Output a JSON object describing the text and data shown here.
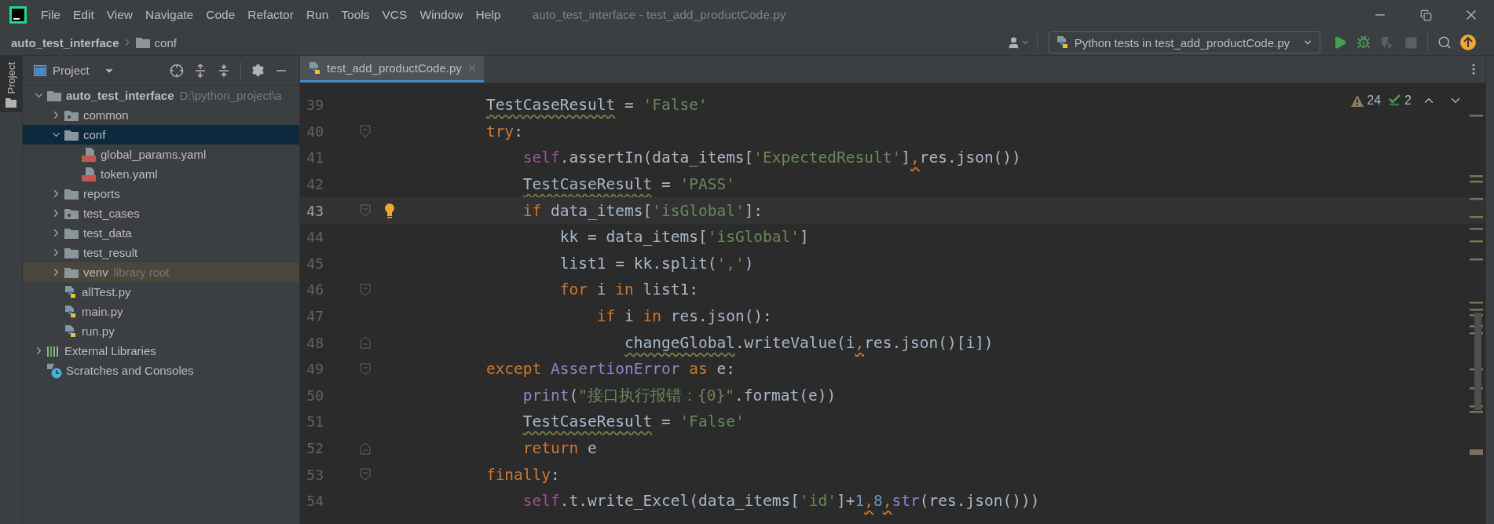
{
  "window": {
    "title": "auto_test_interface - test_add_productCode.py"
  },
  "menu": [
    "File",
    "Edit",
    "View",
    "Navigate",
    "Code",
    "Refactor",
    "Run",
    "Tools",
    "VCS",
    "Window",
    "Help"
  ],
  "breadcrumb": [
    {
      "label": "auto_test_interface",
      "kind": "project"
    },
    {
      "label": "conf",
      "kind": "folder"
    }
  ],
  "toolbar": {
    "run_config": "Python tests in test_add_productCode.py",
    "buttons": [
      {
        "kind": "run",
        "disabled": false
      },
      {
        "kind": "debug",
        "disabled": false
      },
      {
        "kind": "coverage",
        "disabled": true
      },
      {
        "kind": "stop",
        "disabled": true
      },
      {
        "kind": "search",
        "disabled": false
      },
      {
        "kind": "update",
        "disabled": false
      }
    ]
  },
  "tool_strip": {
    "tabs": [
      {
        "label": "Project",
        "selected": true
      }
    ]
  },
  "project_panel": {
    "title": "Project",
    "tree": [
      {
        "label": "auto_test_interface",
        "hint": "D:\\python_project\\a",
        "kind": "project",
        "expanded": true,
        "selected": false,
        "children": [
          {
            "label": "common",
            "kind": "package",
            "expanded": false,
            "selected": false
          },
          {
            "label": "conf",
            "kind": "folder",
            "expanded": true,
            "selected": true,
            "children": [
              {
                "label": "global_params.yaml",
                "kind": "yaml",
                "selected": false
              },
              {
                "label": "token.yaml",
                "kind": "yaml",
                "selected": false
              }
            ]
          },
          {
            "label": "reports",
            "kind": "folder",
            "expanded": false,
            "selected": false
          },
          {
            "label": "test_cases",
            "kind": "package",
            "expanded": false,
            "selected": false
          },
          {
            "label": "test_data",
            "kind": "folder",
            "expanded": false,
            "selected": false
          },
          {
            "label": "test_result",
            "kind": "folder",
            "expanded": false,
            "selected": false
          },
          {
            "label": "venv",
            "hint": "library root",
            "kind": "library-folder",
            "expanded": false,
            "selected": false
          },
          {
            "label": "allTest.py",
            "kind": "python",
            "selected": false
          },
          {
            "label": "main.py",
            "kind": "python",
            "selected": false
          },
          {
            "label": "run.py",
            "kind": "python",
            "selected": false
          }
        ]
      },
      {
        "label": "External Libraries",
        "kind": "libraries",
        "expanded": false,
        "selected": false
      },
      {
        "label": "Scratches and Consoles",
        "kind": "scratches",
        "selected": false
      }
    ]
  },
  "editor": {
    "tabs": [
      {
        "label": "test_add_productCode.py",
        "selected": true
      }
    ],
    "inspections": {
      "warnings": "24",
      "typos": "2"
    },
    "lines": [
      {
        "number": "39",
        "current": false,
        "fold_start": false,
        "fold_end": false,
        "bulb": false,
        "tokens": [
          {
            "text": "            TestCaseResult",
            "kind": "warned"
          },
          {
            "text": " = ",
            "kind": "plain"
          },
          {
            "text": "'False'",
            "kind": "string"
          }
        ]
      },
      {
        "number": "40",
        "current": false,
        "fold_start": true,
        "fold_end": false,
        "bulb": false,
        "tokens": [
          {
            "text": "            try",
            "kind": "keyword"
          },
          {
            "text": ":",
            "kind": "plain"
          }
        ]
      },
      {
        "number": "41",
        "current": false,
        "fold_start": false,
        "fold_end": false,
        "bulb": false,
        "tokens": [
          {
            "text": "                self",
            "kind": "self"
          },
          {
            "text": ".assertIn(data_items[",
            "kind": "plain"
          },
          {
            "text": "'ExpectedResult'",
            "kind": "string"
          },
          {
            "text": "]",
            "kind": "plain"
          },
          {
            "text": ",res.json())",
            "kind": "flagged-plain"
          }
        ]
      },
      {
        "number": "42",
        "current": false,
        "fold_start": false,
        "fold_end": false,
        "bulb": false,
        "tokens": [
          {
            "text": "                TestCaseResult",
            "kind": "warned"
          },
          {
            "text": " = ",
            "kind": "plain"
          },
          {
            "text": "'PASS'",
            "kind": "string"
          }
        ]
      },
      {
        "number": "43",
        "current": true,
        "fold_start": true,
        "fold_end": false,
        "bulb": true,
        "tokens": [
          {
            "text": "                if",
            "kind": "keyword"
          },
          {
            "text": " data_items[",
            "kind": "plain"
          },
          {
            "text": "'isGlobal'",
            "kind": "string"
          },
          {
            "text": "]:",
            "kind": "plain"
          }
        ]
      },
      {
        "number": "44",
        "current": false,
        "fold_start": false,
        "fold_end": false,
        "bulb": false,
        "tokens": [
          {
            "text": "                    kk = data_items[",
            "kind": "plain"
          },
          {
            "text": "'isGlobal'",
            "kind": "string"
          },
          {
            "text": "]",
            "kind": "plain"
          }
        ]
      },
      {
        "number": "45",
        "current": false,
        "fold_start": false,
        "fold_end": false,
        "bulb": false,
        "tokens": [
          {
            "text": "                    list1 = kk.split(",
            "kind": "plain"
          },
          {
            "text": "','",
            "kind": "string"
          },
          {
            "text": ")",
            "kind": "plain"
          }
        ]
      },
      {
        "number": "46",
        "current": false,
        "fold_start": true,
        "fold_end": false,
        "bulb": false,
        "tokens": [
          {
            "text": "                    for",
            "kind": "keyword"
          },
          {
            "text": " i ",
            "kind": "plain"
          },
          {
            "text": "in",
            "kind": "keyword"
          },
          {
            "text": " list1:",
            "kind": "plain"
          }
        ]
      },
      {
        "number": "47",
        "current": false,
        "fold_start": false,
        "fold_end": false,
        "bulb": false,
        "tokens": [
          {
            "text": "                        if",
            "kind": "keyword"
          },
          {
            "text": " i ",
            "kind": "plain"
          },
          {
            "text": "in",
            "kind": "keyword"
          },
          {
            "text": " res.json():",
            "kind": "plain"
          }
        ]
      },
      {
        "number": "48",
        "current": false,
        "fold_start": false,
        "fold_end": true,
        "bulb": false,
        "tokens": [
          {
            "text": "                           changeGlobal",
            "kind": "warned"
          },
          {
            "text": ".writeValue(i",
            "kind": "plain"
          },
          {
            "text": ",res.json()[i])",
            "kind": "flagged-plain"
          }
        ]
      },
      {
        "number": "49",
        "current": false,
        "fold_start": true,
        "fold_end": false,
        "bulb": false,
        "tokens": [
          {
            "text": "            except ",
            "kind": "keyword"
          },
          {
            "text": "AssertionError",
            "kind": "builtin"
          },
          {
            "text": " as",
            "kind": "keyword"
          },
          {
            "text": " e:",
            "kind": "plain"
          }
        ]
      },
      {
        "number": "50",
        "current": false,
        "fold_start": false,
        "fold_end": false,
        "bulb": false,
        "tokens": [
          {
            "text": "                print",
            "kind": "builtin"
          },
          {
            "text": "(",
            "kind": "plain"
          },
          {
            "text": "\"接口执行报错：{0}\"",
            "kind": "string"
          },
          {
            "text": ".format(e))",
            "kind": "plain"
          }
        ]
      },
      {
        "number": "51",
        "current": false,
        "fold_start": false,
        "fold_end": false,
        "bulb": false,
        "tokens": [
          {
            "text": "                TestCaseResult",
            "kind": "warned"
          },
          {
            "text": " = ",
            "kind": "plain"
          },
          {
            "text": "'False'",
            "kind": "string"
          }
        ]
      },
      {
        "number": "52",
        "current": false,
        "fold_start": false,
        "fold_end": true,
        "bulb": false,
        "tokens": [
          {
            "text": "                return",
            "kind": "keyword"
          },
          {
            "text": " e",
            "kind": "plain"
          }
        ]
      },
      {
        "number": "53",
        "current": false,
        "fold_start": true,
        "fold_end": false,
        "bulb": false,
        "tokens": [
          {
            "text": "            finally",
            "kind": "keyword"
          },
          {
            "text": ":",
            "kind": "plain"
          }
        ]
      },
      {
        "number": "54",
        "current": false,
        "fold_start": false,
        "fold_end": false,
        "bulb": false,
        "tokens": [
          {
            "text": "                self",
            "kind": "self"
          },
          {
            "text": ".t.write_Excel(data_items[",
            "kind": "plain"
          },
          {
            "text": "'id'",
            "kind": "string"
          },
          {
            "text": "]+",
            "kind": "plain"
          },
          {
            "text": "1",
            "kind": "number"
          },
          {
            "text": ",8",
            "kind": "flagged-number"
          },
          {
            "text": ",str",
            "kind": "flagged-builtin"
          },
          {
            "text": "(res.json()))",
            "kind": "plain"
          }
        ]
      }
    ]
  }
}
